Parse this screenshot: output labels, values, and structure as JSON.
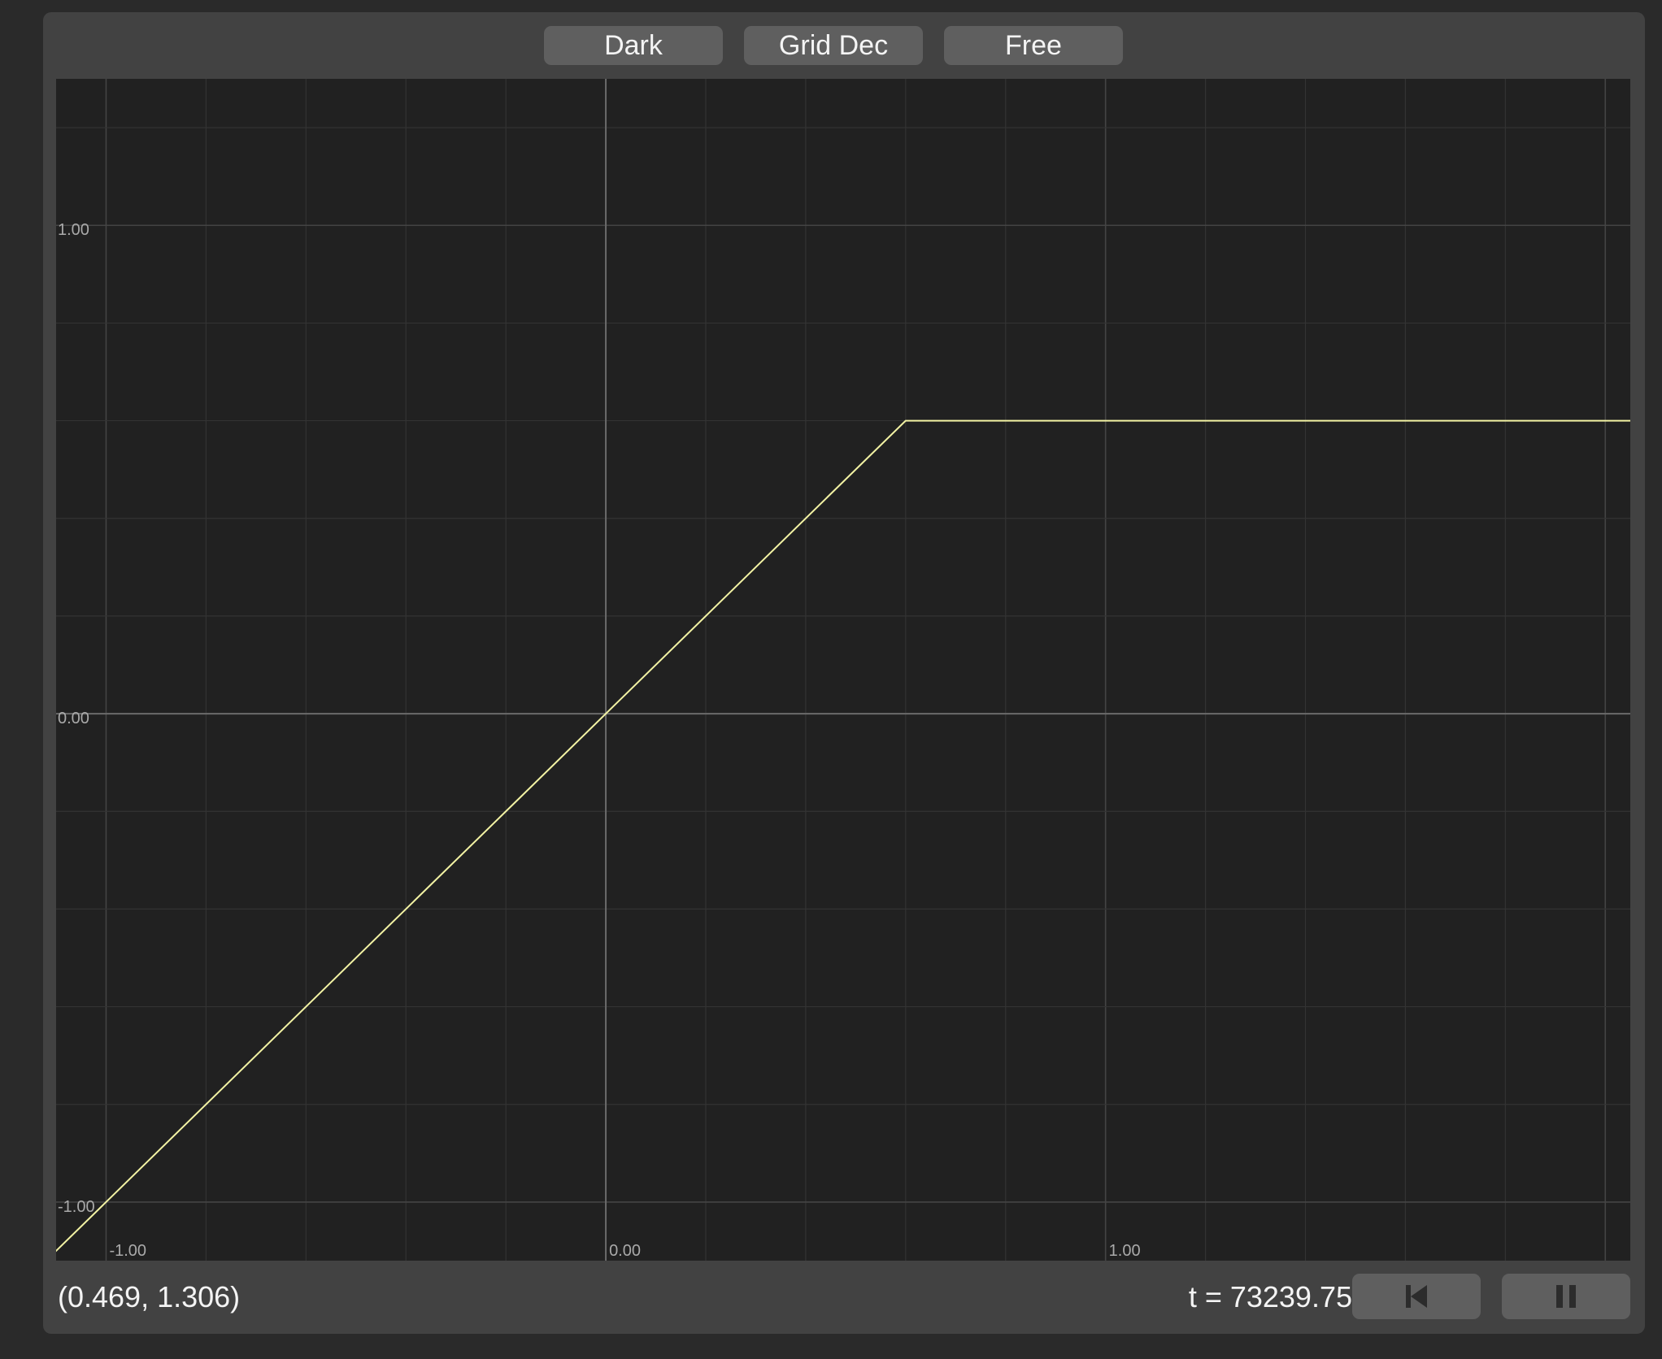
{
  "toolbar": {
    "theme_label": "Dark",
    "grid_label": "Grid Dec",
    "mode_label": "Free"
  },
  "status": {
    "cursor_coords": "(0.469, 1.306)",
    "time_label": "t = 73239.75"
  },
  "controls": {
    "restart_icon": "skip-to-start-icon",
    "pause_icon": "pause-icon"
  },
  "colors": {
    "background": "#2a2a2a",
    "panel": "#424242",
    "button": "#5f5f5f",
    "plot_background": "#212121",
    "curve": "#f3f3a4",
    "major_grid": "#444444",
    "minor_grid": "#333333",
    "axis": "#6a6a6a",
    "tick_label": "#aaaaaa"
  },
  "chart_data": {
    "type": "line",
    "xlim": [
      -1.1,
      2.05
    ],
    "ylim": [
      -1.12,
      1.3
    ],
    "x_ticks": [
      {
        "value": -1,
        "label": "-1.00"
      },
      {
        "value": 0,
        "label": "0.00"
      },
      {
        "value": 1,
        "label": "1.00"
      }
    ],
    "y_ticks": [
      {
        "value": 1,
        "label": "1.00"
      },
      {
        "value": 0,
        "label": "0.00"
      },
      {
        "value": -1,
        "label": "-1.00"
      }
    ],
    "minor_step": 0.2,
    "grid": true,
    "series": [
      {
        "x": [
          -1.2,
          0.6,
          2.05
        ],
        "y": [
          -1.2,
          0.6,
          0.6
        ]
      }
    ]
  }
}
